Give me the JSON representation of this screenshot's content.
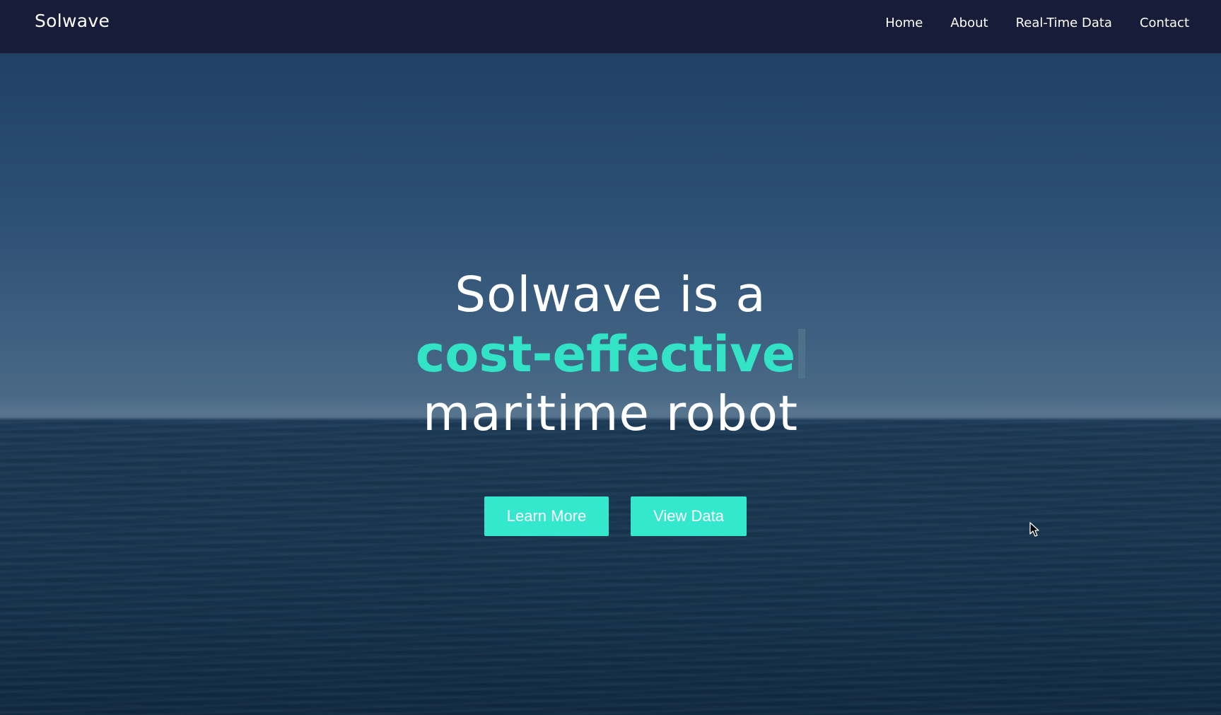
{
  "navbar": {
    "brand": "Solwave",
    "links": [
      "Home",
      "About",
      "Real-Time Data",
      "Contact"
    ]
  },
  "hero": {
    "headline_line1": "Solwave is a",
    "headline_highlight": "cost-effective",
    "headline_line3": "maritime robot",
    "learn_more_label": "Learn More",
    "view_data_label": "View Data"
  },
  "colors": {
    "accent": "#33e3c6",
    "navbar_bg": "#171d38",
    "button_bg": "#33e8cd"
  },
  "icons": {
    "cursor": "mouse-pointer-icon"
  }
}
